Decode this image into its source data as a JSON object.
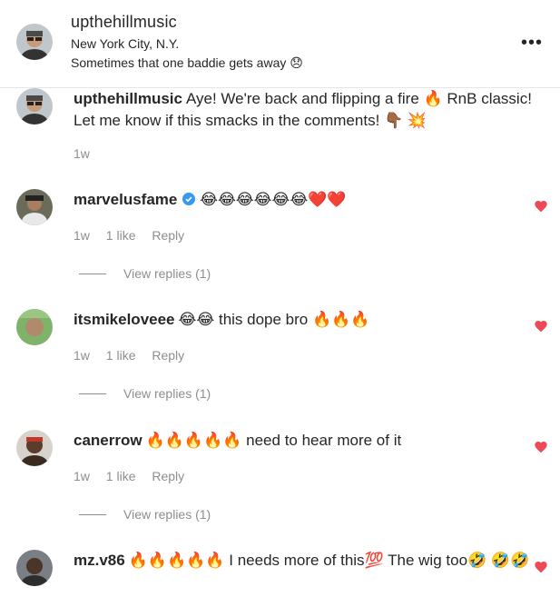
{
  "header": {
    "username": "upthehillmusic",
    "location": "New York City, N.Y.",
    "subtitle": "Sometimes that one baddie gets away 😞",
    "more_label": "•••"
  },
  "caption": {
    "username": "upthehillmusic",
    "text": "Aye! We're back and flipping a fire 🔥 RnB classic! Let me know if this smacks in the comments! 👇🏾 💥",
    "time": "1w"
  },
  "comments": [
    {
      "username": "marvelusfame",
      "verified": true,
      "text": "😂😂😂😂😂😂❤️❤️",
      "time": "1w",
      "likes": "1 like",
      "reply": "Reply",
      "view_replies": "View replies (1)"
    },
    {
      "username": "itsmikeloveee",
      "text": "😂😂 this dope bro 🔥🔥🔥",
      "time": "1w",
      "likes": "1 like",
      "reply": "Reply",
      "view_replies": "View replies (1)"
    },
    {
      "username": "canerrow",
      "text": "🔥🔥🔥🔥🔥 need to hear more of it",
      "time": "1w",
      "likes": "1 like",
      "reply": "Reply",
      "view_replies": "View replies (1)"
    },
    {
      "username": "mz.v86",
      "text": "🔥🔥🔥🔥🔥 I needs more of this💯 The wig too🤣 🤣🤣"
    }
  ],
  "colors": {
    "heart": "#ed4956",
    "muted": "#8e8e8e",
    "verified": "#3897f0"
  }
}
